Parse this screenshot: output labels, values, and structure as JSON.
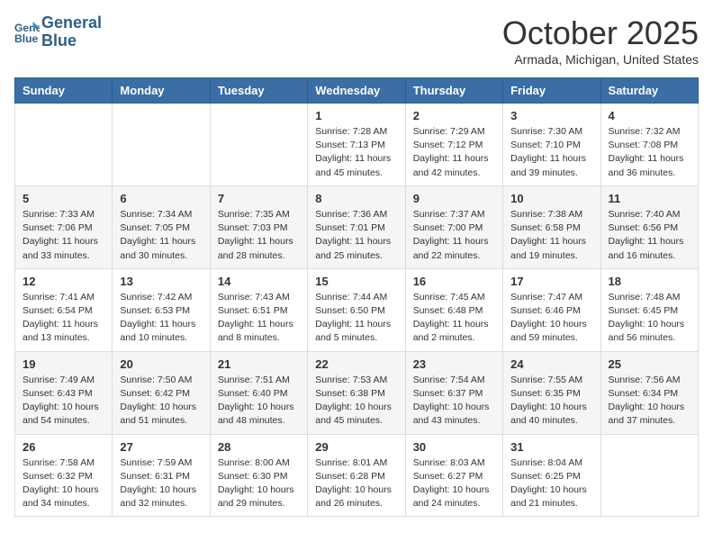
{
  "header": {
    "logo_line1": "General",
    "logo_line2": "Blue",
    "month": "October 2025",
    "location": "Armada, Michigan, United States"
  },
  "days_of_week": [
    "Sunday",
    "Monday",
    "Tuesday",
    "Wednesday",
    "Thursday",
    "Friday",
    "Saturday"
  ],
  "weeks": [
    [
      {
        "day": "",
        "info": ""
      },
      {
        "day": "",
        "info": ""
      },
      {
        "day": "",
        "info": ""
      },
      {
        "day": "1",
        "info": "Sunrise: 7:28 AM\nSunset: 7:13 PM\nDaylight: 11 hours and 45 minutes."
      },
      {
        "day": "2",
        "info": "Sunrise: 7:29 AM\nSunset: 7:12 PM\nDaylight: 11 hours and 42 minutes."
      },
      {
        "day": "3",
        "info": "Sunrise: 7:30 AM\nSunset: 7:10 PM\nDaylight: 11 hours and 39 minutes."
      },
      {
        "day": "4",
        "info": "Sunrise: 7:32 AM\nSunset: 7:08 PM\nDaylight: 11 hours and 36 minutes."
      }
    ],
    [
      {
        "day": "5",
        "info": "Sunrise: 7:33 AM\nSunset: 7:06 PM\nDaylight: 11 hours and 33 minutes."
      },
      {
        "day": "6",
        "info": "Sunrise: 7:34 AM\nSunset: 7:05 PM\nDaylight: 11 hours and 30 minutes."
      },
      {
        "day": "7",
        "info": "Sunrise: 7:35 AM\nSunset: 7:03 PM\nDaylight: 11 hours and 28 minutes."
      },
      {
        "day": "8",
        "info": "Sunrise: 7:36 AM\nSunset: 7:01 PM\nDaylight: 11 hours and 25 minutes."
      },
      {
        "day": "9",
        "info": "Sunrise: 7:37 AM\nSunset: 7:00 PM\nDaylight: 11 hours and 22 minutes."
      },
      {
        "day": "10",
        "info": "Sunrise: 7:38 AM\nSunset: 6:58 PM\nDaylight: 11 hours and 19 minutes."
      },
      {
        "day": "11",
        "info": "Sunrise: 7:40 AM\nSunset: 6:56 PM\nDaylight: 11 hours and 16 minutes."
      }
    ],
    [
      {
        "day": "12",
        "info": "Sunrise: 7:41 AM\nSunset: 6:54 PM\nDaylight: 11 hours and 13 minutes."
      },
      {
        "day": "13",
        "info": "Sunrise: 7:42 AM\nSunset: 6:53 PM\nDaylight: 11 hours and 10 minutes."
      },
      {
        "day": "14",
        "info": "Sunrise: 7:43 AM\nSunset: 6:51 PM\nDaylight: 11 hours and 8 minutes."
      },
      {
        "day": "15",
        "info": "Sunrise: 7:44 AM\nSunset: 6:50 PM\nDaylight: 11 hours and 5 minutes."
      },
      {
        "day": "16",
        "info": "Sunrise: 7:45 AM\nSunset: 6:48 PM\nDaylight: 11 hours and 2 minutes."
      },
      {
        "day": "17",
        "info": "Sunrise: 7:47 AM\nSunset: 6:46 PM\nDaylight: 10 hours and 59 minutes."
      },
      {
        "day": "18",
        "info": "Sunrise: 7:48 AM\nSunset: 6:45 PM\nDaylight: 10 hours and 56 minutes."
      }
    ],
    [
      {
        "day": "19",
        "info": "Sunrise: 7:49 AM\nSunset: 6:43 PM\nDaylight: 10 hours and 54 minutes."
      },
      {
        "day": "20",
        "info": "Sunrise: 7:50 AM\nSunset: 6:42 PM\nDaylight: 10 hours and 51 minutes."
      },
      {
        "day": "21",
        "info": "Sunrise: 7:51 AM\nSunset: 6:40 PM\nDaylight: 10 hours and 48 minutes."
      },
      {
        "day": "22",
        "info": "Sunrise: 7:53 AM\nSunset: 6:38 PM\nDaylight: 10 hours and 45 minutes."
      },
      {
        "day": "23",
        "info": "Sunrise: 7:54 AM\nSunset: 6:37 PM\nDaylight: 10 hours and 43 minutes."
      },
      {
        "day": "24",
        "info": "Sunrise: 7:55 AM\nSunset: 6:35 PM\nDaylight: 10 hours and 40 minutes."
      },
      {
        "day": "25",
        "info": "Sunrise: 7:56 AM\nSunset: 6:34 PM\nDaylight: 10 hours and 37 minutes."
      }
    ],
    [
      {
        "day": "26",
        "info": "Sunrise: 7:58 AM\nSunset: 6:32 PM\nDaylight: 10 hours and 34 minutes."
      },
      {
        "day": "27",
        "info": "Sunrise: 7:59 AM\nSunset: 6:31 PM\nDaylight: 10 hours and 32 minutes."
      },
      {
        "day": "28",
        "info": "Sunrise: 8:00 AM\nSunset: 6:30 PM\nDaylight: 10 hours and 29 minutes."
      },
      {
        "day": "29",
        "info": "Sunrise: 8:01 AM\nSunset: 6:28 PM\nDaylight: 10 hours and 26 minutes."
      },
      {
        "day": "30",
        "info": "Sunrise: 8:03 AM\nSunset: 6:27 PM\nDaylight: 10 hours and 24 minutes."
      },
      {
        "day": "31",
        "info": "Sunrise: 8:04 AM\nSunset: 6:25 PM\nDaylight: 10 hours and 21 minutes."
      },
      {
        "day": "",
        "info": ""
      }
    ]
  ]
}
